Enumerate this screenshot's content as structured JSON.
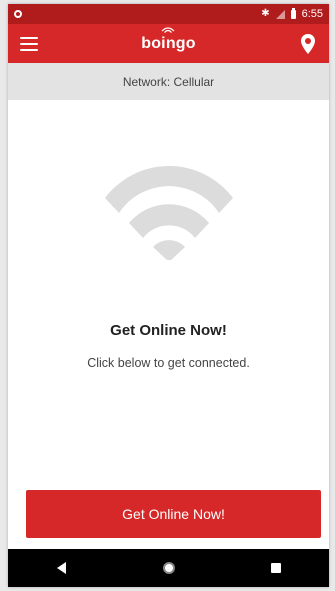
{
  "status_bar": {
    "time": "6:55",
    "icons": [
      "notification-dot-icon",
      "bluetooth-icon",
      "signal-icon",
      "battery-icon"
    ]
  },
  "app_bar": {
    "brand": "boingo",
    "menu_icon": "hamburger-menu-icon",
    "location_icon": "location-pin-icon",
    "color": "#d62828"
  },
  "network": {
    "label": "Network: Cellular"
  },
  "main": {
    "graphic": "wifi-icon",
    "headline": "Get Online Now!",
    "subtext": "Click below to get connected."
  },
  "cta": {
    "label": "Get Online Now!"
  },
  "nav_bar": {
    "buttons": [
      "back-icon",
      "home-icon",
      "recents-icon"
    ]
  },
  "colors": {
    "accent": "#d62828",
    "status_bar": "#b01c1c",
    "wifi_graphic": "#dcdcdc"
  }
}
